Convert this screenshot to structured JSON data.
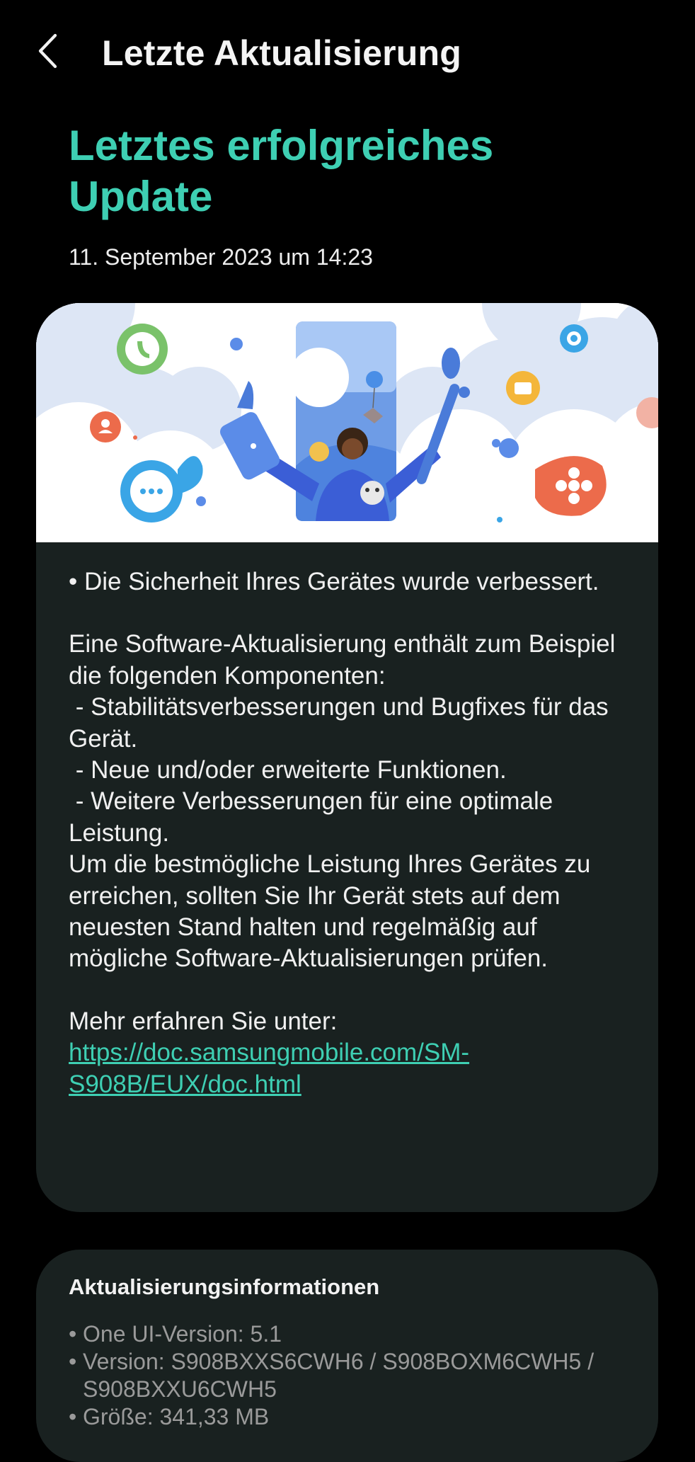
{
  "header": {
    "back_label": "Zurück",
    "title": "Letzte Aktualisierung"
  },
  "hero": {
    "title": "Letztes erfolgreiches Update",
    "date": "11. September 2023 um 14:23"
  },
  "notes": {
    "line1": "• Die Sicherheit Ihres Gerätes wurde verbessert.",
    "line2": "Eine Software-Aktualisierung enthält zum Beispiel die folgenden Komponenten:",
    "line3": " - Stabilitätsverbesserungen und Bugfixes für das Gerät.",
    "line4": " - Neue und/oder erweiterte Funktionen.",
    "line5": " - Weitere Verbesserungen für eine optimale Leistung.",
    "line6": "Um die bestmögliche Leistung Ihres Gerätes zu erreichen, sollten Sie Ihr Gerät stets auf dem neuesten Stand halten und regelmäßig auf mögliche Software-Aktualisierungen prüfen.",
    "more_label": "Mehr erfahren Sie unter:",
    "link": "https://doc.samsungmobile.com/SM-S908B/EUX/doc.html"
  },
  "info": {
    "title": "Aktualisierungsinformationen",
    "items": [
      "One UI-Version: 5.1",
      "Version: S908BXXS6CWH6 / S908BOXM6CWH5 / S908BXXU6CWH5",
      "Größe: 341,33 MB"
    ]
  },
  "colors": {
    "accent": "#3ecfb3",
    "background": "#000000",
    "card": "#192120",
    "secondary_text": "#9a9a9a"
  },
  "icons": {
    "back": "chevron-left-icon"
  }
}
